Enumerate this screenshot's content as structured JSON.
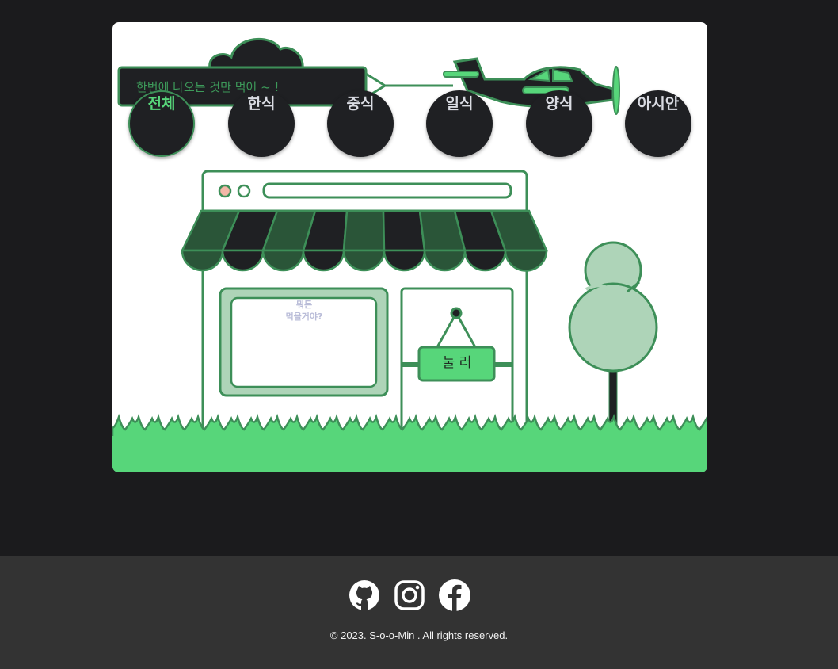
{
  "banner": {
    "text": "한번에 나오는 것만 먹어 ~ !"
  },
  "categories": [
    {
      "label": "전체",
      "active": true
    },
    {
      "label": "한식",
      "active": false
    },
    {
      "label": "중식",
      "active": false
    },
    {
      "label": "일식",
      "active": false
    },
    {
      "label": "양식",
      "active": false
    },
    {
      "label": "아시안",
      "active": false
    }
  ],
  "store": {
    "window_text_line1": "뭐든",
    "window_text_line2": "먹을거야?",
    "sign_button_label": "눌 러"
  },
  "footer": {
    "social": [
      {
        "icon": "github-icon"
      },
      {
        "icon": "instagram-icon"
      },
      {
        "icon": "facebook-icon"
      }
    ],
    "copyright": "© 2023. S-o-o-Min . All rights reserved."
  },
  "colors": {
    "page_bg": "#1b1b1d",
    "card_bg": "#ffffff",
    "accent_green": "#57d67a",
    "dark_green": "#3d8f58",
    "awning_dark": "#2a5538",
    "tree_fill": "#aed4b8",
    "footer_bg": "#333333"
  }
}
